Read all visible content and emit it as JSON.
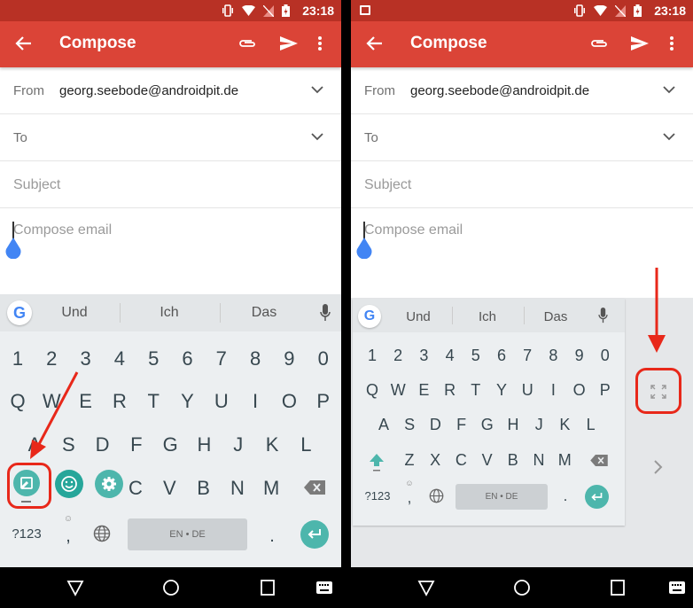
{
  "status_bar": {
    "time": "23:18",
    "icons": [
      "vibrate-icon",
      "wifi-icon",
      "no-sim-icon",
      "battery-charging-icon"
    ]
  },
  "app_bar": {
    "title": "Compose",
    "back": "back-arrow-icon",
    "attach": "paperclip-icon",
    "send": "send-icon",
    "more": "more-vert-icon"
  },
  "form": {
    "from_label": "From",
    "from_value": "georg.seebode@androidpit.de",
    "to_label": "To",
    "subject_placeholder": "Subject",
    "body_placeholder": "Compose email"
  },
  "keyboard": {
    "suggestions": [
      "Und",
      "Ich",
      "Das"
    ],
    "number_row": [
      "1",
      "2",
      "3",
      "4",
      "5",
      "6",
      "7",
      "8",
      "9",
      "0"
    ],
    "row1": [
      "Q",
      "W",
      "E",
      "R",
      "T",
      "Y",
      "U",
      "I",
      "O",
      "P"
    ],
    "row2": [
      "A",
      "S",
      "D",
      "F",
      "G",
      "H",
      "J",
      "K",
      "L"
    ],
    "row3_left": [
      "C",
      "V",
      "B",
      "N",
      "M"
    ],
    "row3_right": [
      "Z",
      "X",
      "C",
      "V",
      "B",
      "N",
      "M"
    ],
    "symbols_key": "?123",
    "comma": ",",
    "period": ".",
    "space_label": "EN • DE",
    "google_letter": "G"
  },
  "annotations": {
    "left": "Arrow pointing to one-handed mode button",
    "right": "Arrow pointing to expand keyboard button"
  },
  "colors": {
    "accent_red": "#db4437",
    "status_red": "#b83125",
    "teal": "#4db6ac",
    "annotation": "#e8281a",
    "handle_blue": "#4285f4"
  }
}
